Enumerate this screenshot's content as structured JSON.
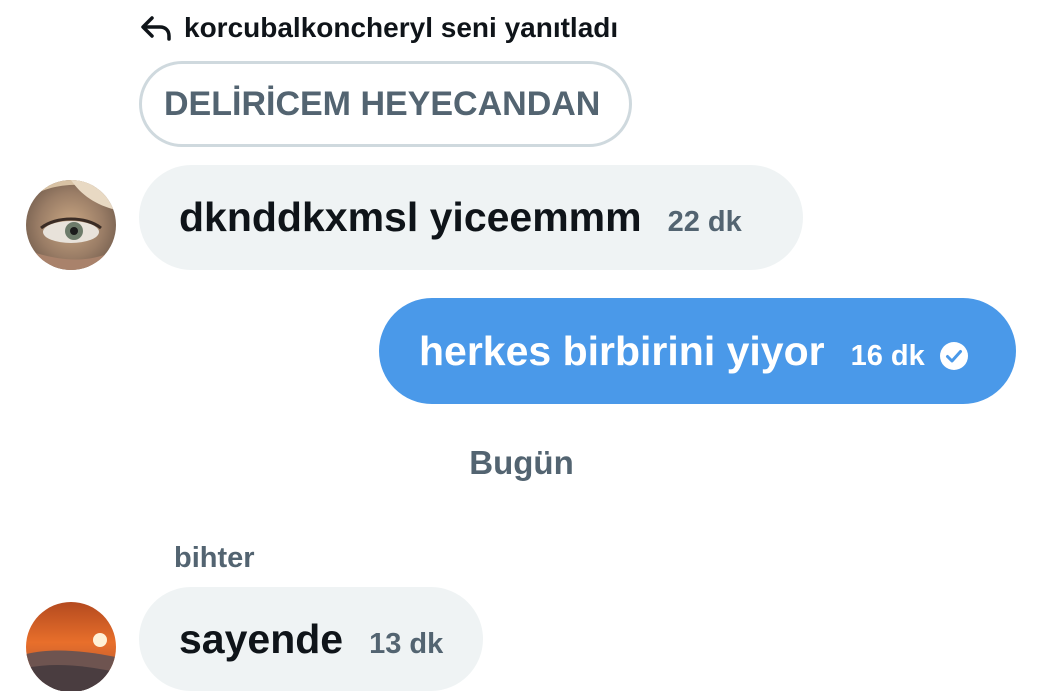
{
  "reply_header": {
    "text": "korcubalkoncheryl seni yanıtladı",
    "icon": "reply-arrow-icon"
  },
  "quoted_message": {
    "text": "DELİRİCEM HEYECANDAN"
  },
  "messages": [
    {
      "direction": "incoming",
      "text": "dknddkxmsl yiceemmm",
      "time": "22 dk"
    },
    {
      "direction": "outgoing",
      "text": "herkes birbirini yiyor",
      "time": "16 dk",
      "status_icon": "read-check-icon"
    },
    {
      "direction": "incoming",
      "sender": "bihter",
      "text": "sayende",
      "time": "13 dk"
    }
  ],
  "date_separator": "Bugün",
  "colors": {
    "outgoing_bubble": "#4a99e9",
    "incoming_bubble": "#eff3f4",
    "secondary_text": "#536471",
    "primary_text": "#0f1419",
    "quote_border": "#cfd9de"
  }
}
